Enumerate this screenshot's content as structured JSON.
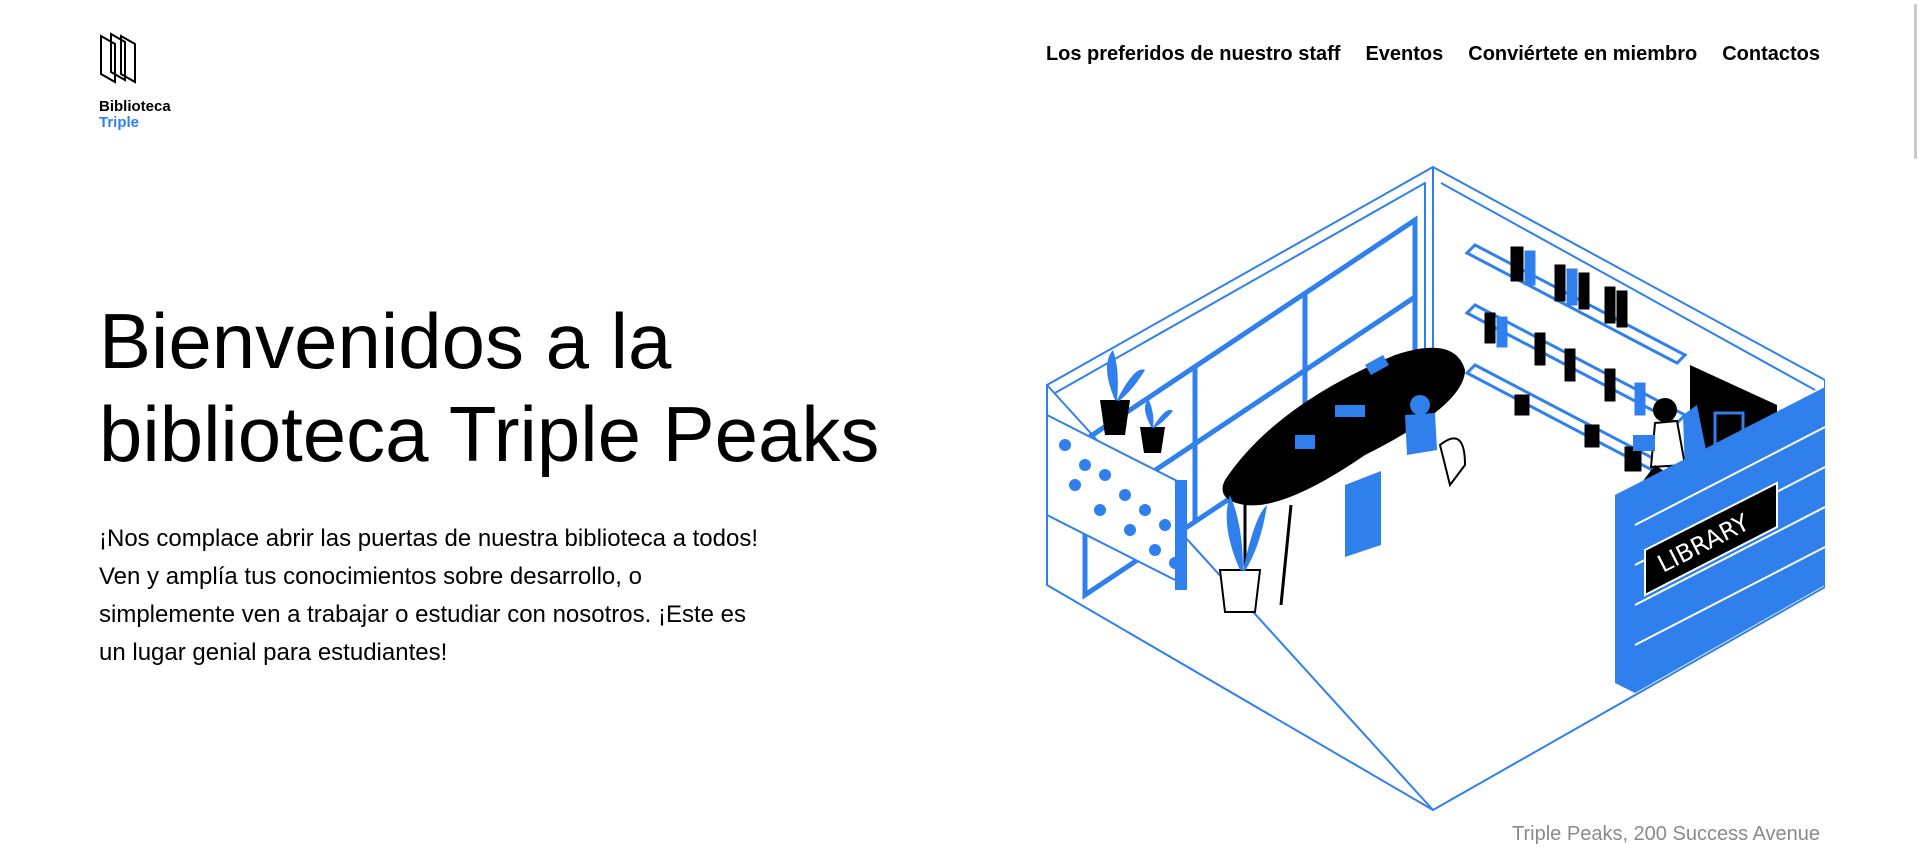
{
  "logo": {
    "line1": "Biblioteca",
    "line2": "Triple",
    "icon": "books-outline-icon"
  },
  "nav": {
    "items": [
      {
        "label": "Los preferidos de nuestro staff"
      },
      {
        "label": "Eventos"
      },
      {
        "label": "Conviértete en miembro"
      },
      {
        "label": "Contactos"
      }
    ]
  },
  "hero": {
    "title_line1": "Bienvenidos a la",
    "title_line2": "biblioteca Triple Peaks",
    "paragraph1": "¡Nos complace abrir las puertas de nuestra biblioteca a todos!",
    "paragraph2": "Ven y amplía tus conocimientos sobre desarrollo, o simplemente ven a trabajar o estudiar con nosotros. ¡Este es un lugar genial para estudiantes!"
  },
  "illustration": {
    "sign_text": "LIBRARY",
    "thought_text": "??"
  },
  "footer": {
    "address": "Triple Peaks, 200 Success Avenue"
  },
  "colors": {
    "accent": "#2F80ED",
    "text": "#000000",
    "muted": "#8a8a8a",
    "background": "#ffffff"
  }
}
